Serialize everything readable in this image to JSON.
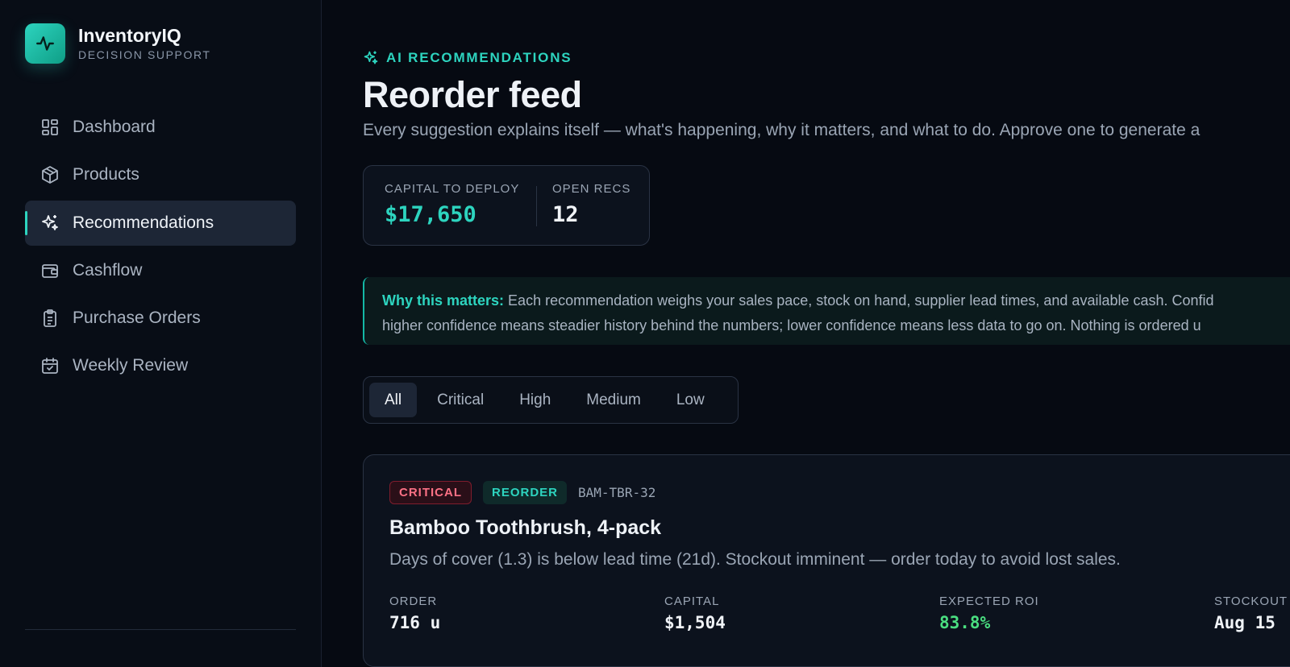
{
  "brand": {
    "name": "InventoryIQ",
    "subtitle": "DECISION SUPPORT"
  },
  "nav": {
    "items": [
      {
        "label": "Dashboard",
        "icon": "dashboard-icon",
        "active": false
      },
      {
        "label": "Products",
        "icon": "package-icon",
        "active": false
      },
      {
        "label": "Recommendations",
        "icon": "sparkles-icon",
        "active": true
      },
      {
        "label": "Cashflow",
        "icon": "wallet-icon",
        "active": false
      },
      {
        "label": "Purchase Orders",
        "icon": "clipboard-icon",
        "active": false
      },
      {
        "label": "Weekly Review",
        "icon": "calendar-check-icon",
        "active": false
      }
    ]
  },
  "header": {
    "eyebrow": "AI RECOMMENDATIONS",
    "title": "Reorder feed",
    "subtitle": "Every suggestion explains itself — what's happening, why it matters, and what to do. Approve one to generate a"
  },
  "stats": {
    "capital_label": "CAPITAL TO DEPLOY",
    "capital_value": "$17,650",
    "open_label": "OPEN RECS",
    "open_value": "12"
  },
  "callout": {
    "lead": "Why this matters:",
    "line1": "Each recommendation weighs your sales pace, stock on hand, supplier lead times, and available cash. Confid",
    "line2": "higher confidence means steadier history behind the numbers; lower confidence means less data to go on. Nothing is ordered u"
  },
  "filters": [
    "All",
    "Critical",
    "High",
    "Medium",
    "Low"
  ],
  "active_filter": "All",
  "card": {
    "priority": "CRITICAL",
    "type": "REORDER",
    "sku": "BAM-TBR-32",
    "title": "Bamboo Toothbrush, 4-pack",
    "description": "Days of cover (1.3) is below lead time (21d). Stockout imminent — order today to avoid lost sales.",
    "metrics": {
      "order_label": "ORDER",
      "order_value": "716 u",
      "capital_label": "CAPITAL",
      "capital_value": "$1,504",
      "roi_label": "EXPECTED ROI",
      "roi_value": "83.8%",
      "stockout_label": "STOCKOUT",
      "stockout_value": "Aug 15"
    }
  },
  "colors": {
    "accent": "#2dd4bf",
    "critical": "#fb7185",
    "positive": "#4ade80",
    "background": "#060a12"
  }
}
